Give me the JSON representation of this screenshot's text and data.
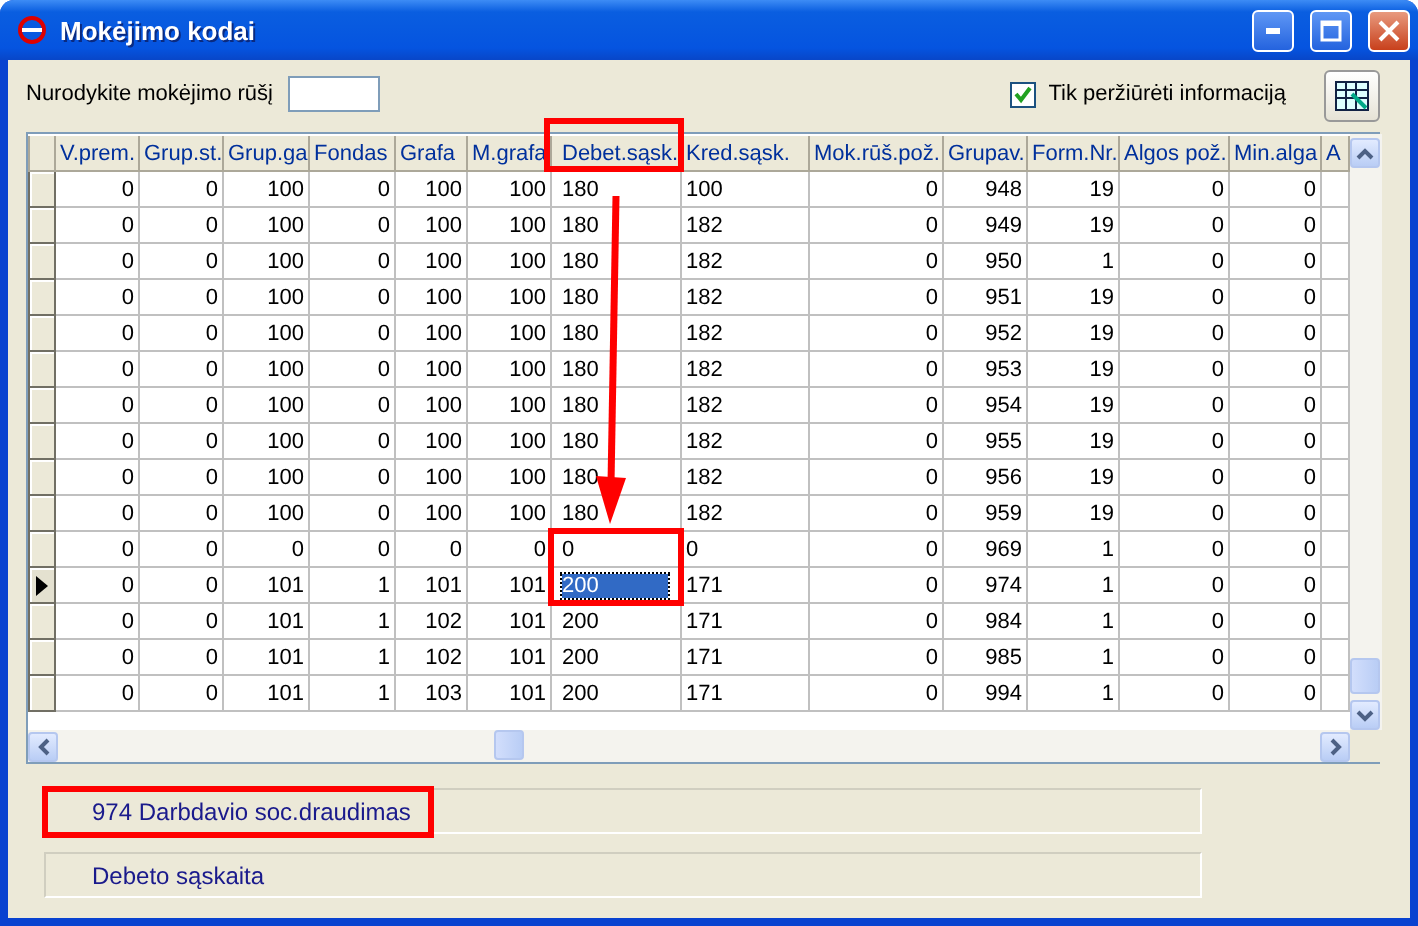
{
  "window": {
    "title": "Mokėjimo kodai"
  },
  "filter": {
    "label": "Nurodykite mokėjimo rūšį"
  },
  "view_only": {
    "label": "Tik peržiūrėti informaciją",
    "checked": true
  },
  "table": {
    "columns": [
      {
        "label": "V.prem.",
        "kind": "number",
        "focused": false
      },
      {
        "label": "Grup.st.",
        "kind": "number",
        "focused": false
      },
      {
        "label": "Grup.ga",
        "kind": "number",
        "focused": false
      },
      {
        "label": "Fondas",
        "kind": "number",
        "focused": false
      },
      {
        "label": "Grafa",
        "kind": "number",
        "focused": false
      },
      {
        "label": "M.grafa",
        "kind": "number",
        "focused": false
      },
      {
        "label": "Debet.sąsk.",
        "kind": "text",
        "focused": true
      },
      {
        "label": "Kred.sąsk.",
        "kind": "text",
        "focused": false
      },
      {
        "label": "Mok.rūš.pož.",
        "kind": "number",
        "focused": false
      },
      {
        "label": "Grupav.",
        "kind": "number",
        "focused": false
      },
      {
        "label": "Form.Nr.",
        "kind": "number",
        "focused": false
      },
      {
        "label": "Algos pož.",
        "kind": "number",
        "focused": false
      },
      {
        "label": "Min.alga",
        "kind": "number",
        "focused": false
      },
      {
        "label": "A",
        "kind": "text",
        "focused": false
      }
    ],
    "rows": [
      {
        "selected": false,
        "cells": [
          "0",
          "0",
          "100",
          "0",
          "100",
          "100",
          "180",
          "100",
          "0",
          "948",
          "19",
          "0",
          "0"
        ]
      },
      {
        "selected": false,
        "cells": [
          "0",
          "0",
          "100",
          "0",
          "100",
          "100",
          "180",
          "182",
          "0",
          "949",
          "19",
          "0",
          "0"
        ]
      },
      {
        "selected": false,
        "cells": [
          "0",
          "0",
          "100",
          "0",
          "100",
          "100",
          "180",
          "182",
          "0",
          "950",
          "1",
          "0",
          "0"
        ]
      },
      {
        "selected": false,
        "cells": [
          "0",
          "0",
          "100",
          "0",
          "100",
          "100",
          "180",
          "182",
          "0",
          "951",
          "19",
          "0",
          "0"
        ]
      },
      {
        "selected": false,
        "cells": [
          "0",
          "0",
          "100",
          "0",
          "100",
          "100",
          "180",
          "182",
          "0",
          "952",
          "19",
          "0",
          "0"
        ]
      },
      {
        "selected": false,
        "cells": [
          "0",
          "0",
          "100",
          "0",
          "100",
          "100",
          "180",
          "182",
          "0",
          "953",
          "19",
          "0",
          "0"
        ]
      },
      {
        "selected": false,
        "cells": [
          "0",
          "0",
          "100",
          "0",
          "100",
          "100",
          "180",
          "182",
          "0",
          "954",
          "19",
          "0",
          "0"
        ]
      },
      {
        "selected": false,
        "cells": [
          "0",
          "0",
          "100",
          "0",
          "100",
          "100",
          "180",
          "182",
          "0",
          "955",
          "19",
          "0",
          "0"
        ]
      },
      {
        "selected": false,
        "cells": [
          "0",
          "0",
          "100",
          "0",
          "100",
          "100",
          "180",
          "182",
          "0",
          "956",
          "19",
          "0",
          "0"
        ]
      },
      {
        "selected": false,
        "cells": [
          "0",
          "0",
          "100",
          "0",
          "100",
          "100",
          "180",
          "182",
          "0",
          "959",
          "19",
          "0",
          "0"
        ]
      },
      {
        "selected": false,
        "cells": [
          "0",
          "0",
          "0",
          "0",
          "0",
          "0",
          "0",
          "0",
          "0",
          "969",
          "1",
          "0",
          "0"
        ]
      },
      {
        "selected": true,
        "cells": [
          "0",
          "0",
          "101",
          "1",
          "101",
          "101",
          "200",
          "171",
          "0",
          "974",
          "1",
          "0",
          "0"
        ]
      },
      {
        "selected": false,
        "cells": [
          "0",
          "0",
          "101",
          "1",
          "102",
          "101",
          "200",
          "171",
          "0",
          "984",
          "1",
          "0",
          "0"
        ]
      },
      {
        "selected": false,
        "cells": [
          "0",
          "0",
          "101",
          "1",
          "102",
          "101",
          "200",
          "171",
          "0",
          "985",
          "1",
          "0",
          "0"
        ]
      },
      {
        "selected": false,
        "cells": [
          "0",
          "0",
          "101",
          "1",
          "103",
          "101",
          "200",
          "171",
          "0",
          "994",
          "1",
          "0",
          "0"
        ]
      }
    ]
  },
  "status": [
    "974 Darbdavio soc.draudimas",
    "Debeto sąskaita"
  ]
}
